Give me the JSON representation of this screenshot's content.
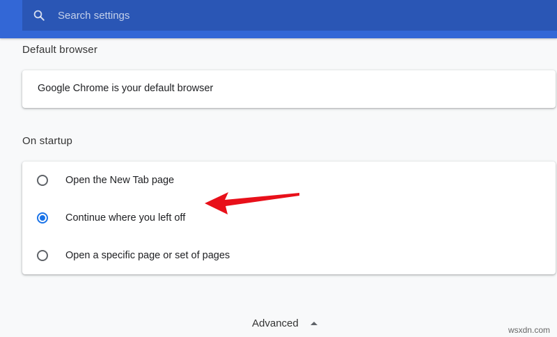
{
  "header": {
    "search_placeholder": "Search settings",
    "search_icon": "search-icon"
  },
  "default_browser": {
    "title": "Default browser",
    "status_text": "Google Chrome is your default browser"
  },
  "on_startup": {
    "title": "On startup",
    "options": [
      {
        "label": "Open the New Tab page",
        "selected": false
      },
      {
        "label": "Continue where you left off",
        "selected": true
      },
      {
        "label": "Open a specific page or set of pages",
        "selected": false
      }
    ]
  },
  "footer": {
    "advanced_label": "Advanced",
    "advanced_icon": "triangle-up-icon"
  },
  "annotation": {
    "arrow_color": "#e8101a"
  },
  "watermark": "wsxdn.com",
  "colors": {
    "header_bg": "#3367d6",
    "search_bg": "#2a56b5",
    "accent": "#1a73e8",
    "page_bg": "#f8f9fa"
  }
}
